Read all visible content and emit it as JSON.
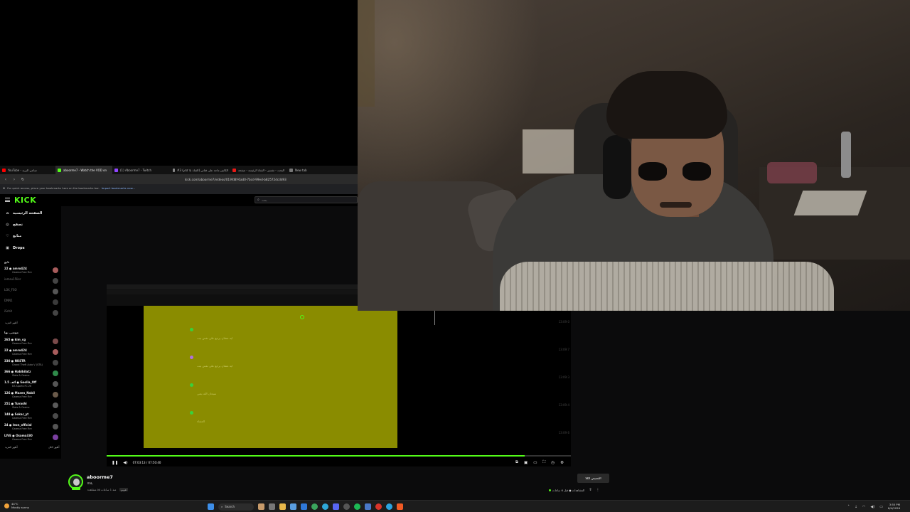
{
  "browser": {
    "tabs": [
      {
        "label": "YouTube - ساعي البريد",
        "color": "#ff0000",
        "active": false
      },
      {
        "label": "aboorme7 - Watch the VOD on",
        "color": "#53fc18",
        "active": true
      },
      {
        "label": "(1) Aboorme7 - Twitch",
        "color": "#9146ff",
        "active": false
      },
      {
        "label": "#3 الكابتن ماجد على قناتي (القناة بلا كلام)",
        "color": "#888888",
        "active": false
      },
      {
        "label": "البحث - تفسير - القناة الرئيسة - صفحة",
        "color": "#e91916",
        "active": false
      },
      {
        "label": "New tab",
        "color": "#777777",
        "active": false
      }
    ],
    "url": "kick.com/aboorme7/videos/019fd8f-6ad0-7bcd-99ed-b82572dcdd93",
    "bookmarks_text": "For quick access, place your bookmarks here on the bookmarks bar.",
    "bookmarks_link": "Import bookmarks now..."
  },
  "kick": {
    "logo": "KICK",
    "search_placeholder": "بحث",
    "nav": [
      {
        "label": "الصفحة الرئيسية",
        "icon": "home-icon",
        "glyph": "⌂"
      },
      {
        "label": "تصفح",
        "icon": "compass-icon",
        "glyph": "◎"
      },
      {
        "label": "متابع",
        "icon": "heart-icon",
        "glyph": "♡"
      },
      {
        "label": "Drops",
        "icon": "gift-icon",
        "glyph": "▣"
      }
    ],
    "following_title": "تابع",
    "following": [
      {
        "name": "22 ● amro424",
        "game": "Garena Free Fire",
        "live": true
      },
      {
        "name": "iamsu15lier",
        "game": "",
        "live": false
      },
      {
        "name": "LOX_FSO",
        "game": "",
        "live": false
      },
      {
        "name": "DNN1",
        "game": "",
        "live": false
      },
      {
        "name": "iSchit",
        "game": "",
        "live": false
      }
    ],
    "show_more_1": "أظهر المزيد",
    "recommended_title": "موصى بها",
    "recommended": [
      {
        "name": "265 ● kim_cg",
        "game": "Garena Free Fire"
      },
      {
        "name": "22 ● amro424",
        "game": "Garena Free Fire"
      },
      {
        "name": "330 ● NKSTR",
        "game": "Grand Theft Auto V (GTA)"
      },
      {
        "name": "366 ● Habibilatz",
        "game": "Slots & Casino"
      },
      {
        "name": "1.5 ألف ● Goolia_Off",
        "game": "EA Sports FC 26"
      },
      {
        "name": "126 ● Mazen_Nabil",
        "game": "Garena Free Fire"
      },
      {
        "name": "251 ● Tuvashi",
        "game": "Slots & Casino"
      },
      {
        "name": "148 ● Sokar_yt",
        "game": "Garena Free Fire"
      },
      {
        "name": "24 ● leon_official",
        "game": "Garena Free Fire"
      },
      {
        "name": "LIVE ● Osama330",
        "game": "Garena Free Fire"
      }
    ],
    "show_more_2": "أظهر المزيد",
    "show_all": "أظهر الكل"
  },
  "player": {
    "chat_lines": [
      "ايه عشان يرجع علي نفس نيت",
      "ايه عشان يرجع علي نفس نيت",
      "سبحان الله يعني",
      "العشاء"
    ],
    "timestamps": [
      "13:09:0",
      "13:09:7",
      "13:09:3",
      "13:09:4",
      "13:09:6"
    ],
    "timecode": "07:03:13 / 07:50:40",
    "progress": 0.9
  },
  "channel": {
    "name": "aboorme7",
    "subtitle": "يلاااا",
    "meta": "منذ 1 ساعات ٥٥ مشاهدة",
    "tag": "عربي",
    "clip_label": "القصيص الكلا",
    "views_text": "المشاهدات ● قبل 6 ساعات"
  },
  "taskbar": {
    "weather_temp": "44°C",
    "weather_desc": "Mostly sunny",
    "search_label": "Search",
    "time": "3:55 PM",
    "date": "8/4/2026"
  },
  "colors": {
    "accent": "#53fc18",
    "yellow_screen": "#8a8c00"
  }
}
